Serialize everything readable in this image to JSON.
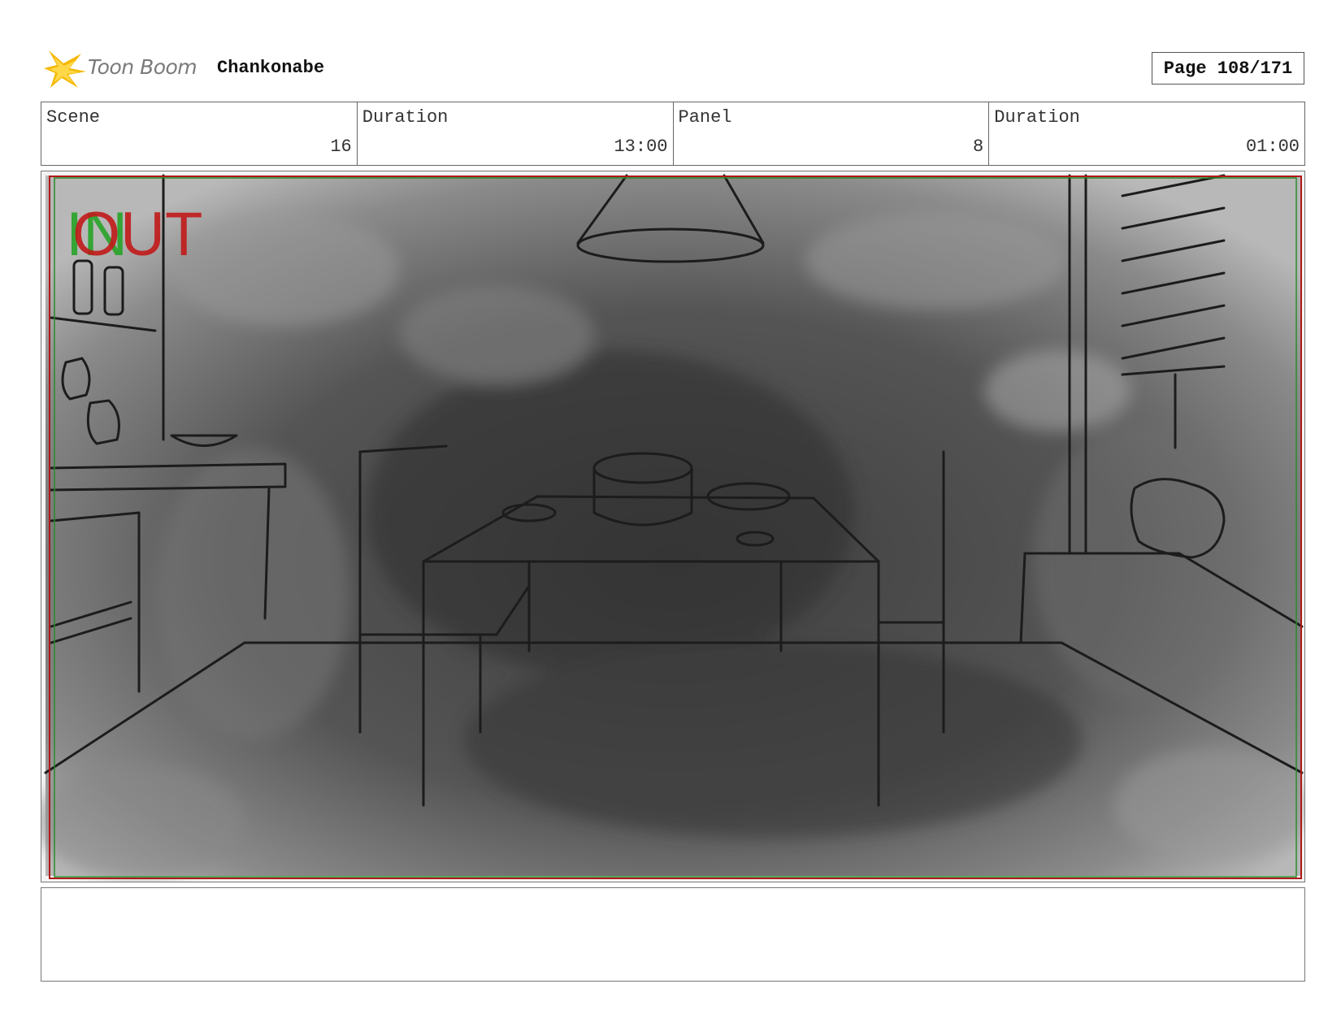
{
  "header": {
    "logo_text": "Toon Boom",
    "project_title": "Chankonabe",
    "page_label": "Page 108/171"
  },
  "info": {
    "scene_label": "Scene",
    "scene_value": "16",
    "scene_duration_label": "Duration",
    "scene_duration_value": "13:00",
    "panel_label": "Panel",
    "panel_value": "8",
    "panel_duration_label": "Duration",
    "panel_duration_value": "01:00"
  },
  "panel": {
    "in_marker": "IN",
    "out_marker": "OUT"
  },
  "notes": {
    "text": ""
  },
  "colors": {
    "in_marker": "#27a327",
    "out_marker": "#c21a1a",
    "safe_frame_red": "#b01818",
    "safe_frame_green": "#2b8a2b"
  }
}
